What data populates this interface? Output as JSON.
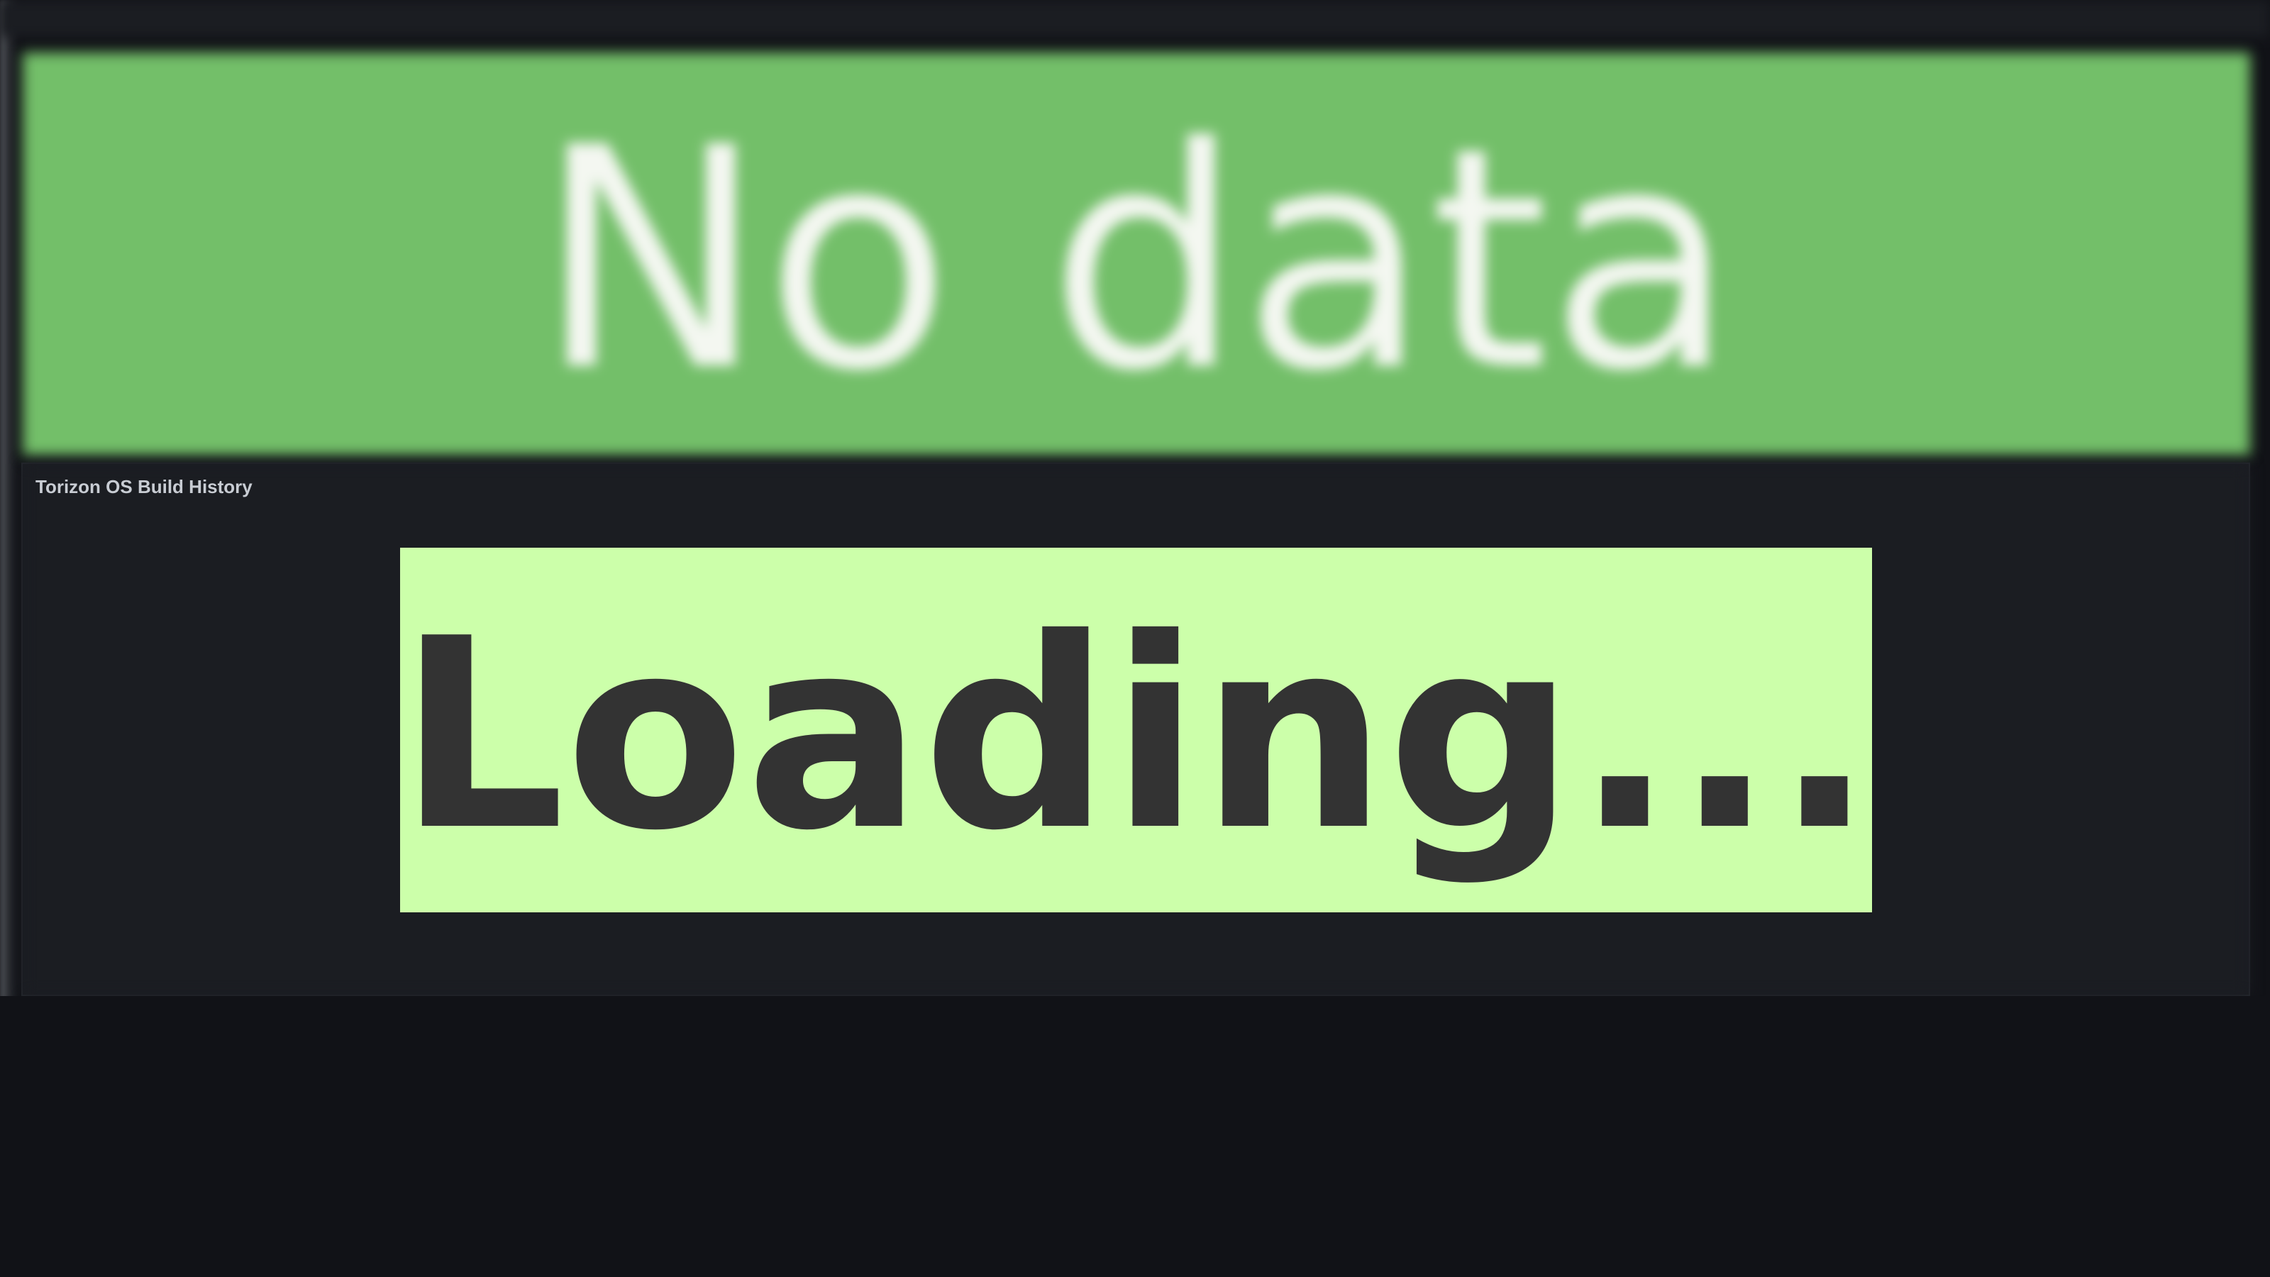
{
  "dashboard": {
    "top_panel": {
      "title": "",
      "value": "No data",
      "color": "#73bf69"
    },
    "history_panel": {
      "title": "Torizon OS Build History",
      "loading_text": "Loading...",
      "loading_background": "#ccffaa",
      "loading_text_color": "#333333"
    }
  }
}
